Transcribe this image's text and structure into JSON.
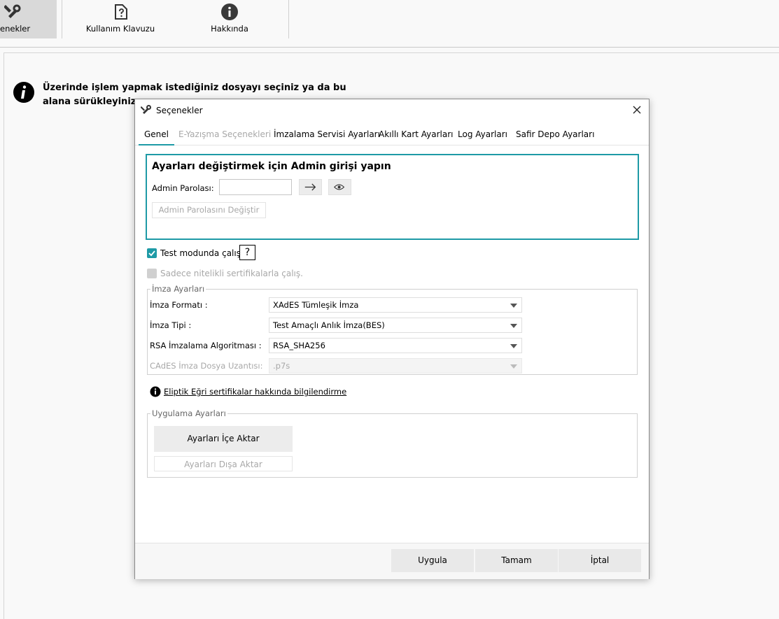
{
  "toolbar": {
    "items": [
      {
        "label": "enekler",
        "icon": "wrench-screwdriver-icon"
      },
      {
        "label": "Kullanım Klavuzu",
        "icon": "help-document-icon"
      },
      {
        "label": "Hakkında",
        "icon": "info-icon"
      }
    ]
  },
  "main": {
    "info_text": "Üzerinde işlem yapmak istediğiniz dosyayı seçiniz ya da bu alana sürükleyiniz."
  },
  "dialog": {
    "title": "Seçenekler",
    "tabs": [
      {
        "label": "Genel",
        "active": true,
        "enabled": true
      },
      {
        "label": "E-Yazışma Seçenekleri",
        "active": false,
        "enabled": false
      },
      {
        "label": "İmzalama Servisi Ayarları",
        "active": false,
        "enabled": true
      },
      {
        "label": "Akıllı Kart Ayarları",
        "active": false,
        "enabled": true
      },
      {
        "label": "Log Ayarları",
        "active": false,
        "enabled": true
      },
      {
        "label": "Safir Depo Ayarları",
        "active": false,
        "enabled": true
      }
    ],
    "admin": {
      "heading": "Ayarları değiştirmek için Admin girişi yapın",
      "password_label": "Admin Parolası:",
      "password_value": "",
      "change_password_label": "Admin Parolasını Değiştir"
    },
    "test_mode": {
      "label": "Test modunda çalış.",
      "checked": true,
      "help": "?"
    },
    "qualified_only": {
      "label": "Sadece nitelikli sertifikalarla çalış.",
      "checked": false
    },
    "signature_settings": {
      "title": "İmza Ayarları",
      "rows": [
        {
          "label": "İmza Formatı :",
          "value": "XAdES Tümleşik İmza",
          "enabled": true
        },
        {
          "label": "İmza Tipi :",
          "value": "Test Amaçlı Anlık İmza(BES)",
          "enabled": true
        },
        {
          "label": "RSA İmzalama Algoritması :",
          "value": "RSA_SHA256",
          "enabled": true
        },
        {
          "label": "CAdES İmza Dosya Uzantısı:",
          "value": ".p7s",
          "enabled": false
        }
      ]
    },
    "ecc_link": "Eliptik Eğri sertifikalar hakkında bilgilendirme",
    "app_settings": {
      "title": "Uygulama Ayarları",
      "import_label": "Ayarları İçe Aktar",
      "export_label": "Ayarları Dışa Aktar"
    },
    "footer": {
      "apply": "Uygula",
      "ok": "Tamam",
      "cancel": "İptal"
    },
    "accent_color": "#1e9aa6"
  }
}
